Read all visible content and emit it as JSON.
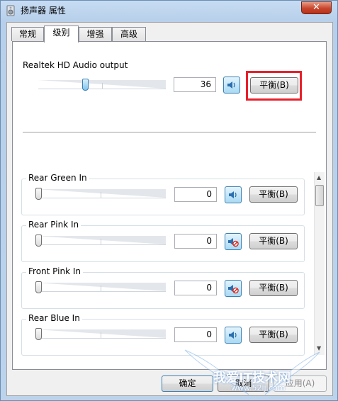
{
  "window": {
    "title": "扬声器 属性",
    "close_glyph": "✕"
  },
  "tabs": [
    {
      "label": "常规"
    },
    {
      "label": "级别"
    },
    {
      "label": "增强"
    },
    {
      "label": "高级"
    }
  ],
  "main_output": {
    "label": "Realtek HD Audio output",
    "volume": "36",
    "level_fraction": 0.36,
    "speaker_icon": "speaker-icon",
    "balance_label": "平衡(B)"
  },
  "inputs": [
    {
      "label": "Rear Green In",
      "volume": "0",
      "muted": false,
      "speaker_icon": "speaker-icon",
      "balance_label": "平衡(B)"
    },
    {
      "label": "Rear Pink In",
      "volume": "0",
      "muted": true,
      "speaker_icon": "speaker-muted-icon",
      "balance_label": "平衡(B)"
    },
    {
      "label": "Front Pink In",
      "volume": "0",
      "muted": true,
      "speaker_icon": "speaker-muted-icon",
      "balance_label": "平衡(B)"
    },
    {
      "label": "Rear Blue In",
      "volume": "0",
      "muted": false,
      "speaker_icon": "speaker-icon",
      "balance_label": "平衡(B)"
    }
  ],
  "footer": {
    "ok_label": "确定",
    "cancel_label": "取消",
    "apply_label": "应用(A)"
  },
  "watermark": {
    "text": "我爱IT技术网",
    "sub": "www.52ij.com"
  },
  "colors": {
    "highlight": "#e8202a",
    "accent": "#3c7fb1",
    "muted_badge": "#d9261c"
  }
}
